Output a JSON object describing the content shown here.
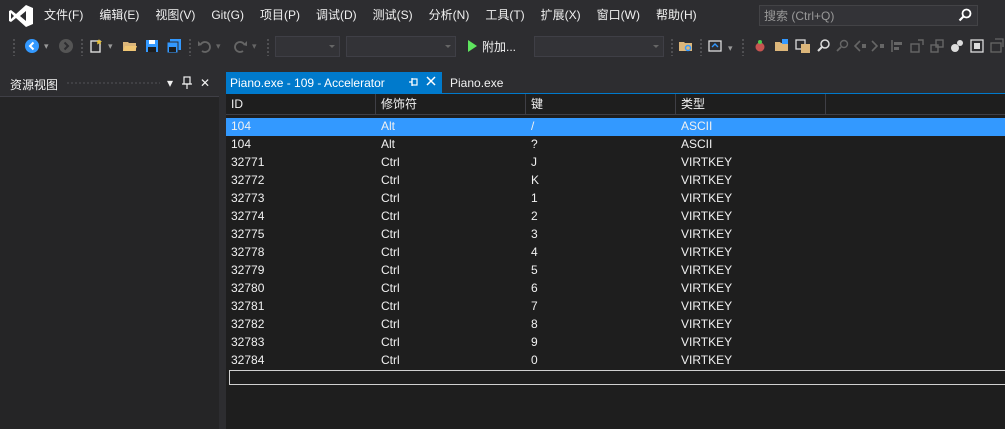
{
  "menu": {
    "items": [
      "文件(F)",
      "编辑(E)",
      "视图(V)",
      "Git(G)",
      "项目(P)",
      "调试(D)",
      "测试(S)",
      "分析(N)",
      "工具(T)",
      "扩展(X)",
      "窗口(W)",
      "帮助(H)"
    ],
    "search_placeholder": "搜索 (Ctrl+Q)"
  },
  "toolbar": {
    "run_label": "附加...",
    "icons": [
      "back-icon",
      "forward-icon",
      "new-project-icon",
      "open-icon",
      "save-icon",
      "save-all-icon",
      "undo-icon",
      "redo-icon",
      "run-icon",
      "find-in-files-icon",
      "solution-explorer-icon",
      "bookmark-icon"
    ],
    "run_color": "#5ee45e",
    "accent": "#007acc"
  },
  "left_panel": {
    "title": "资源视图",
    "menu_glyph": "▾",
    "pin_glyph": "ᚹ",
    "close_glyph": "✕"
  },
  "tabs": [
    {
      "label": "Piano.exe - 109 - Accelerator",
      "active": true
    },
    {
      "label": "Piano.exe",
      "active": false
    }
  ],
  "table": {
    "columns": [
      "ID",
      "修饰符",
      "键",
      "类型"
    ],
    "selected_index": 0,
    "rows": [
      [
        "104",
        "Alt",
        "/",
        "ASCII"
      ],
      [
        "104",
        "Alt",
        "?",
        "ASCII"
      ],
      [
        "32771",
        "Ctrl",
        "J",
        "VIRTKEY"
      ],
      [
        "32772",
        "Ctrl",
        "K",
        "VIRTKEY"
      ],
      [
        "32773",
        "Ctrl",
        "1",
        "VIRTKEY"
      ],
      [
        "32774",
        "Ctrl",
        "2",
        "VIRTKEY"
      ],
      [
        "32775",
        "Ctrl",
        "3",
        "VIRTKEY"
      ],
      [
        "32778",
        "Ctrl",
        "4",
        "VIRTKEY"
      ],
      [
        "32779",
        "Ctrl",
        "5",
        "VIRTKEY"
      ],
      [
        "32780",
        "Ctrl",
        "6",
        "VIRTKEY"
      ],
      [
        "32781",
        "Ctrl",
        "7",
        "VIRTKEY"
      ],
      [
        "32782",
        "Ctrl",
        "8",
        "VIRTKEY"
      ],
      [
        "32783",
        "Ctrl",
        "9",
        "VIRTKEY"
      ],
      [
        "32784",
        "Ctrl",
        "0",
        "VIRTKEY"
      ]
    ]
  }
}
